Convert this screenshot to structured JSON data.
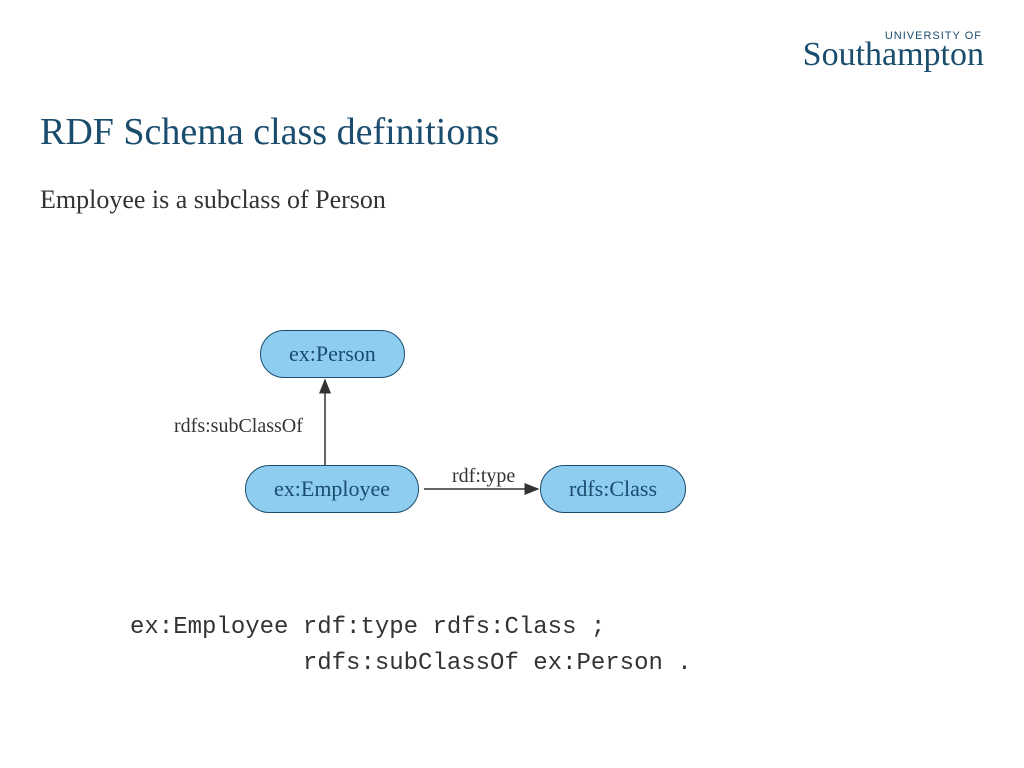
{
  "logo": {
    "small": "UNIVERSITY OF",
    "main": "Southampton"
  },
  "title": "RDF Schema class definitions",
  "subtitle": "Employee is a subclass of Person",
  "nodes": {
    "person": "ex:Person",
    "employee": "ex:Employee",
    "class": "rdfs:Class"
  },
  "edges": {
    "subclass": "rdfs:subClassOf",
    "type": "rdf:type"
  },
  "code": {
    "line1": "ex:Employee rdf:type rdfs:Class ;",
    "line2": "            rdfs:subClassOf ex:Person ."
  },
  "colors": {
    "brand": "#1a4d6d",
    "node_fill": "#8ecdf0",
    "text": "#333333"
  }
}
